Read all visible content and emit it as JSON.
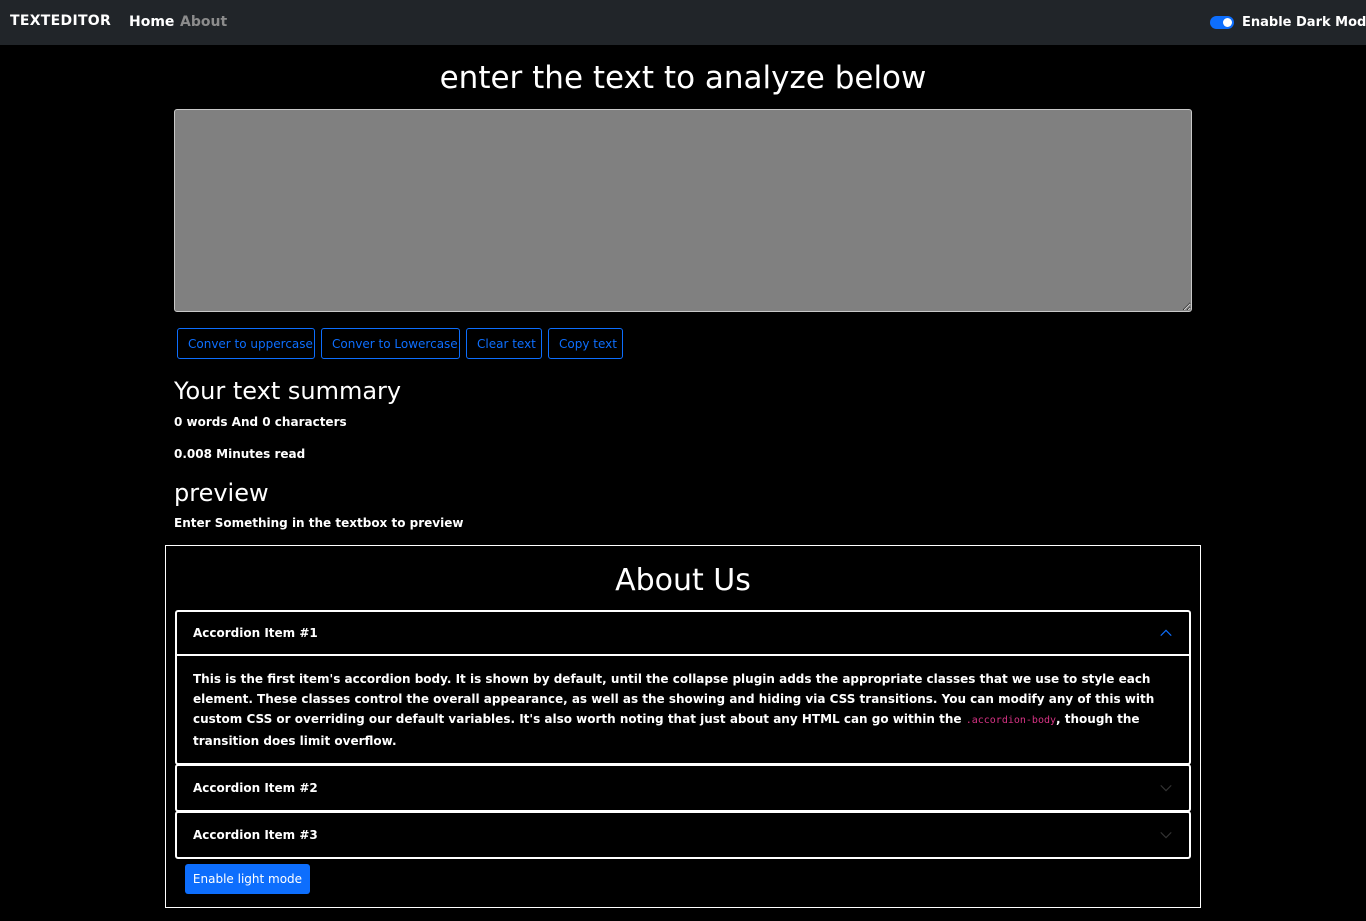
{
  "navbar": {
    "brand": "TEXTEDITOR",
    "links": [
      "Home",
      "About"
    ],
    "dark_mode_label": "Enable Dark Mode",
    "dark_mode_on": true
  },
  "main": {
    "heading": "enter the text to analyze below",
    "textarea_value": "",
    "buttons": {
      "uppercase": "Conver to uppercase",
      "lowercase": "Conver to Lowercase",
      "clear": "Clear text",
      "copy": "Copy text"
    },
    "summary": {
      "title": "Your text summary",
      "words_line": "0 words And 0 characters",
      "minutes_line": "0.008 Minutes read"
    },
    "preview": {
      "title": "preview",
      "text": "Enter Something in the textbox to preview"
    }
  },
  "about": {
    "title": "About Us",
    "accordion": [
      {
        "label": "Accordion Item #1",
        "open": true,
        "body_before_code": "This is the first item's accordion body. It is shown by default, until the collapse plugin adds the appropriate classes that we use to style each element. These classes control the overall appearance, as well as the showing and hiding via CSS transitions. You can modify any of this with custom CSS or overriding our default variables. It's also worth noting that just about any HTML can go within the ",
        "body_code": ".accordion-body",
        "body_after_code": ", though the transition does limit overflow."
      },
      {
        "label": "Accordion Item #2",
        "open": false
      },
      {
        "label": "Accordion Item #3",
        "open": false
      }
    ],
    "light_mode_button": "Enable light mode"
  },
  "colors": {
    "accent": "#0d6efd",
    "navbar_bg": "#212529",
    "textarea_bg": "#808080",
    "code": "#d63384"
  },
  "icons": {
    "open_chevron": "chevron-up-icon",
    "closed_chevron": "chevron-down-icon"
  }
}
